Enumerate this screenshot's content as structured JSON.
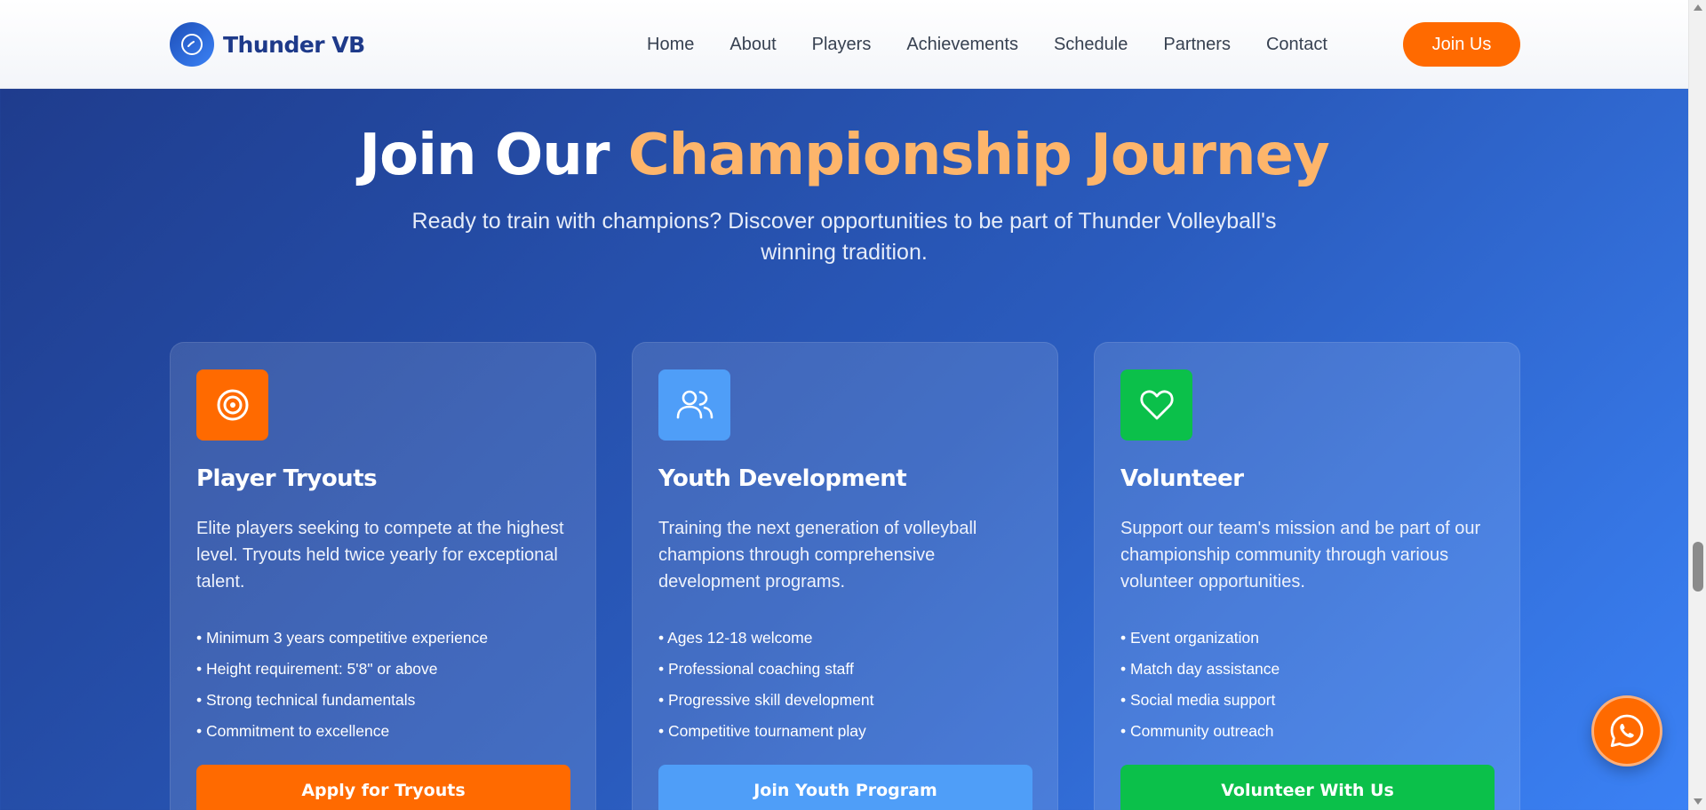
{
  "header": {
    "brand_name": "Thunder VB",
    "nav": [
      "Home",
      "About",
      "Players",
      "Achievements",
      "Schedule",
      "Partners",
      "Contact"
    ],
    "cta_label": "Join Us"
  },
  "hero": {
    "title_part1": "Join Our",
    "title_accent": "Championship Journey",
    "subtitle": "Ready to train with champions? Discover opportunities to be part of Thunder Volleyball's winning tradition."
  },
  "cards": [
    {
      "icon": "target-icon",
      "icon_color": "#ff6a00",
      "title": "Player Tryouts",
      "description": "Elite players seeking to compete at the highest level. Tryouts held twice yearly for exceptional talent.",
      "items": [
        "• Minimum 3 years competitive experience",
        "• Height requirement: 5'8\" or above",
        "• Strong technical fundamentals",
        "• Commitment to excellence"
      ],
      "button_label": "Apply for Tryouts",
      "button_color": "#ff6a00"
    },
    {
      "icon": "users-icon",
      "icon_color": "#4f9ef8",
      "title": "Youth Development",
      "description": "Training the next generation of volleyball champions through comprehensive development programs.",
      "items": [
        "• Ages 12-18 welcome",
        "• Professional coaching staff",
        "• Progressive skill development",
        "• Competitive tournament play"
      ],
      "button_label": "Join Youth Program",
      "button_color": "#4f9ef8"
    },
    {
      "icon": "heart-icon",
      "icon_color": "#0bc04a",
      "title": "Volunteer",
      "description": "Support our team's mission and be part of our championship community through various volunteer opportunities.",
      "items": [
        "• Event organization",
        "• Match day assistance",
        "• Social media support",
        "• Community outreach"
      ],
      "button_label": "Volunteer With Us",
      "button_color": "#0bc04a"
    }
  ],
  "fab": {
    "icon": "whatsapp-icon",
    "color": "#ff6a00"
  }
}
